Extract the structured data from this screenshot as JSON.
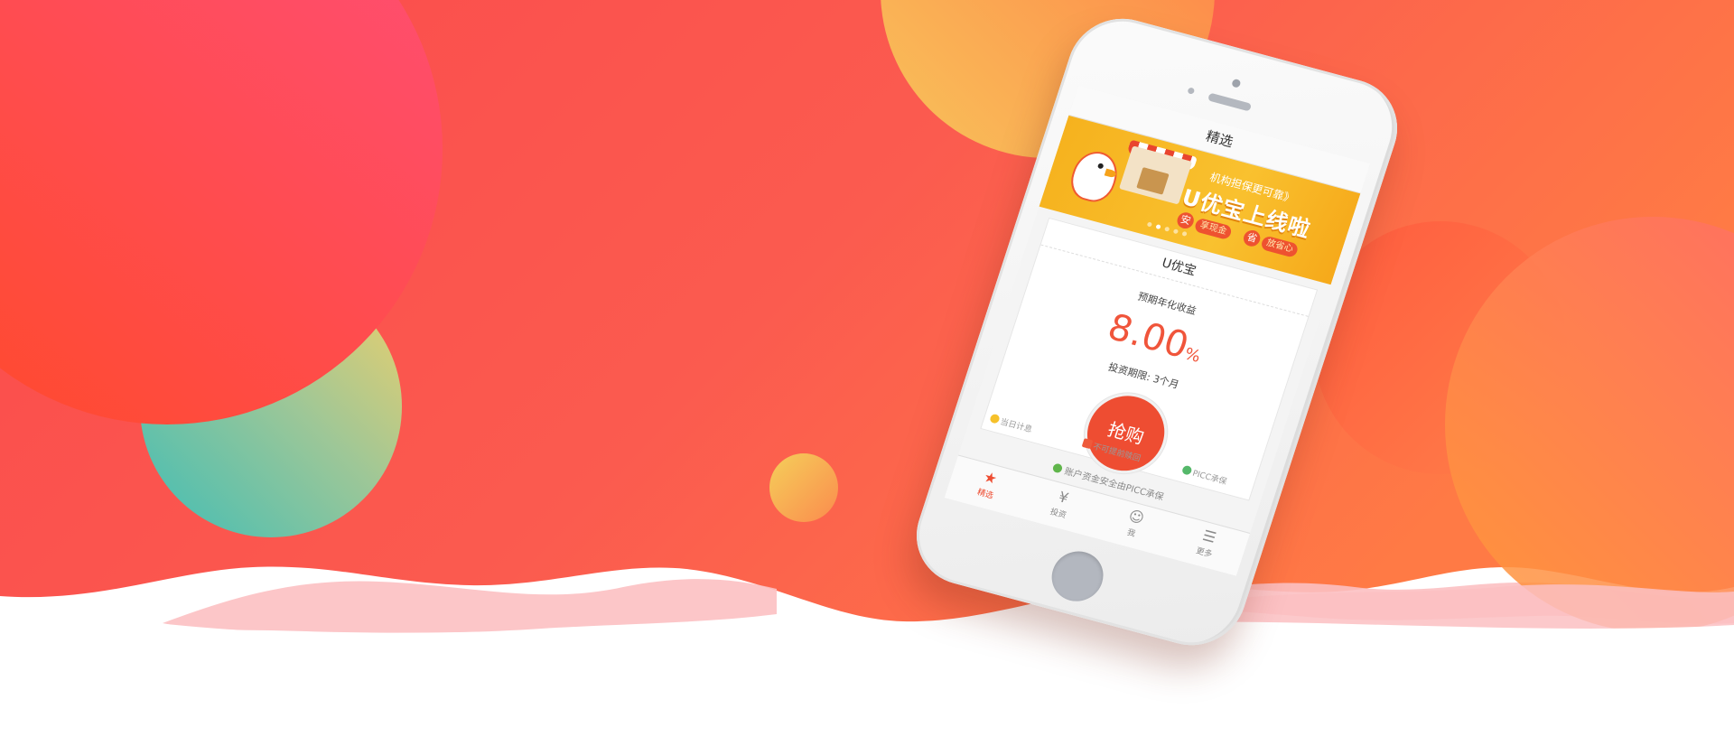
{
  "phone_screen": {
    "title": "精选",
    "banner": {
      "slogan": "机构担保更可靠》",
      "headline": "U优宝上线啦",
      "tag1_char": "安",
      "tag1_text": "享现金",
      "tag2_char": "省",
      "tag2_text": "放省心",
      "active_dot": 2,
      "dot_count": 5
    },
    "product": {
      "name": "U优宝",
      "yield_label": "预期年化收益",
      "yield_value": "8.00",
      "yield_unit": "%",
      "term": "投资期限: 3个月",
      "buy_label": "抢购",
      "features": [
        "当日计息",
        "不可提前赎回",
        "PICC承保"
      ]
    },
    "notice": "账户资金安全由PICC承保",
    "tabs": [
      {
        "label": "精选",
        "icon": "star-icon",
        "glyph": "★",
        "active": true
      },
      {
        "label": "投资",
        "icon": "yuan-coin-icon",
        "glyph": "¥",
        "active": false
      },
      {
        "label": "我",
        "icon": "user-icon",
        "glyph": "☺",
        "active": false
      },
      {
        "label": "更多",
        "icon": "menu-icon",
        "glyph": "☰",
        "active": false
      }
    ]
  },
  "colors": {
    "bg_gradient_start": "#fb4a4c",
    "bg_gradient_end": "#ff7a3d",
    "accent": "#ee4d32",
    "banner_yellow": "#f8b924"
  }
}
